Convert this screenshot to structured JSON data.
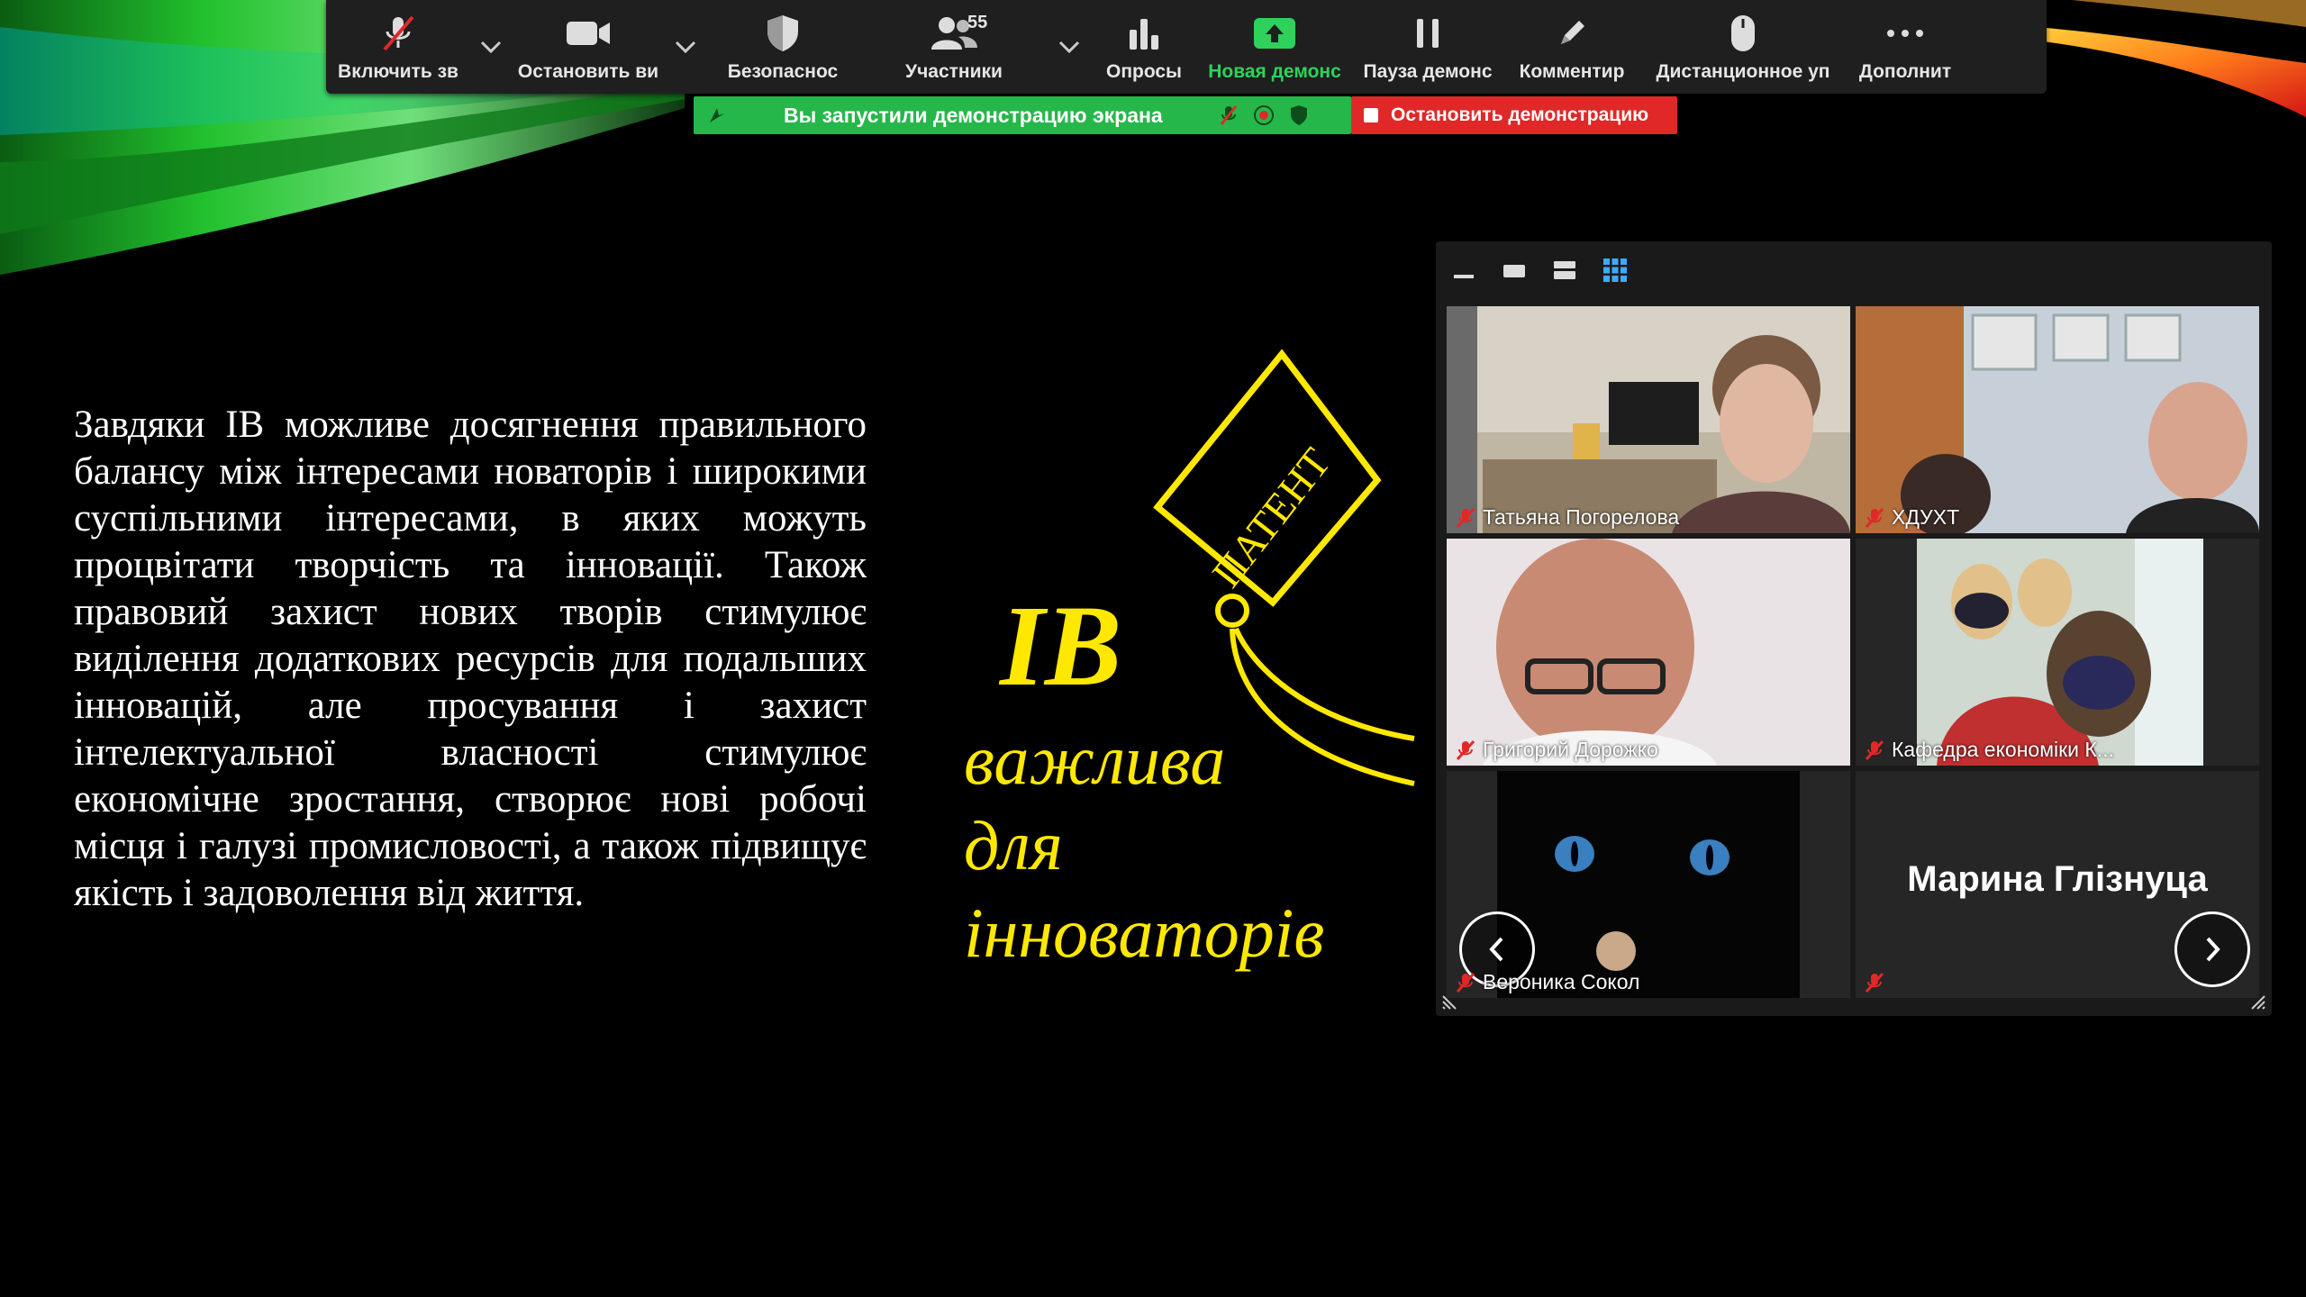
{
  "toolbar": {
    "items": [
      {
        "label": "Включить зв",
        "icon": "microphone-muted-icon"
      },
      {
        "label": "Остановить ви",
        "icon": "video-camera-icon"
      },
      {
        "label": "Безопаснос",
        "icon": "shield-icon"
      },
      {
        "label": "Участники",
        "icon": "participants-icon",
        "count": "55"
      },
      {
        "label": "Опросы",
        "icon": "polls-icon"
      },
      {
        "label": "Новая демонс",
        "icon": "share-screen-icon"
      },
      {
        "label": "Пауза демонс",
        "icon": "pause-icon"
      },
      {
        "label": "Комментир",
        "icon": "annotate-pencil-icon"
      },
      {
        "label": "Дистанционное уп",
        "icon": "remote-control-mouse-icon"
      },
      {
        "label": "Дополнит",
        "icon": "more-dots-icon"
      }
    ]
  },
  "share_bar": {
    "message": "Вы запустили демонстрацию экрана",
    "stop_label": "Остановить демонстрацию"
  },
  "slide": {
    "body": "Завдяки ІВ можливе досягнення правильного балансу між інтересами новаторів і широкими суспільними інтересами, в яких можуть процвітати творчість та інновації. Також правовий захист нових творів стимулює виділення додаткових ресурсів для подальших інновацій, але просування і захист інтелектуальної власності стимулює економічне зростання, створює нові робочі місця і галузі промисловості, а також підвищує якість і задоволення від життя.",
    "patent_label": "ПАТЕНТ",
    "ib_title": "ІВ",
    "line1": "важлива",
    "line2": "для",
    "line3": "інноваторів"
  },
  "gallery": {
    "participants": [
      {
        "name": "Татьяна Погорелова"
      },
      {
        "name": "ХДУХТ"
      },
      {
        "name": "Григорий Дорожко"
      },
      {
        "name": "Кафедра економіки К..."
      },
      {
        "name": "Вероника Сокол"
      },
      {
        "name": "",
        "big_name": "Марина Глізнуца"
      }
    ]
  },
  "colors": {
    "toolbar_bg": "#1f1f1f",
    "share_green": "#26b74a",
    "stop_red": "#e02828",
    "slide_accent": "#ffe800"
  }
}
